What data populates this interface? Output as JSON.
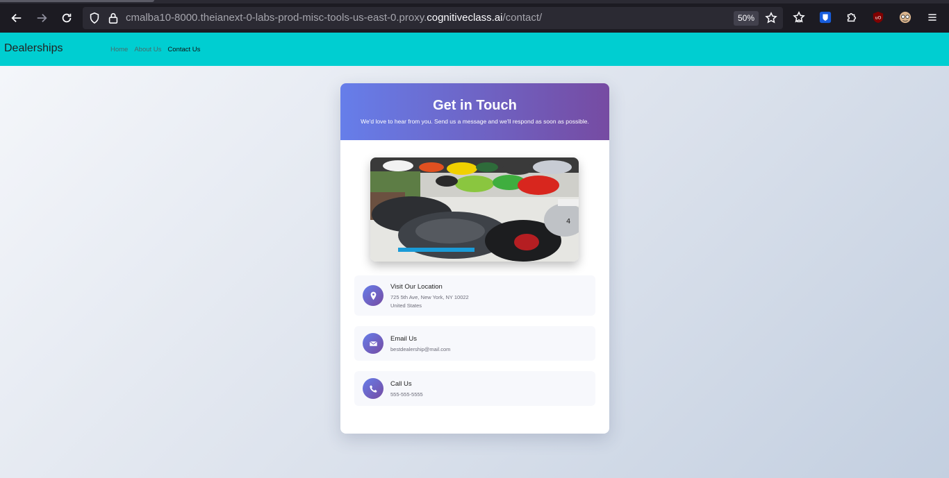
{
  "browser": {
    "url_prefix": "cmalba10-8000.theianext-0-labs-prod-misc-tools-us-east-0.proxy.",
    "url_host": "cognitiveclass.ai",
    "url_path": "/contact/",
    "zoom": "50%"
  },
  "navbar": {
    "brand": "Dealerships",
    "links": [
      {
        "label": "Home"
      },
      {
        "label": "About Us"
      },
      {
        "label": "Contact Us"
      }
    ]
  },
  "contact": {
    "title": "Get in Touch",
    "subtitle": "We'd love to hear from you. Send us a message and we'll respond as soon as possible.",
    "location": {
      "title": "Visit Our Location",
      "line1": "725 5th Ave, New York, NY 10022",
      "line2": "United States"
    },
    "email": {
      "title": "Email Us",
      "value": "bestdealership@mail.com"
    },
    "phone": {
      "title": "Call Us",
      "value": "555-555-5555"
    }
  },
  "colors": {
    "navbar": "#00ced1",
    "header_gradient_start": "#667eea",
    "header_gradient_end": "#764ba2"
  }
}
